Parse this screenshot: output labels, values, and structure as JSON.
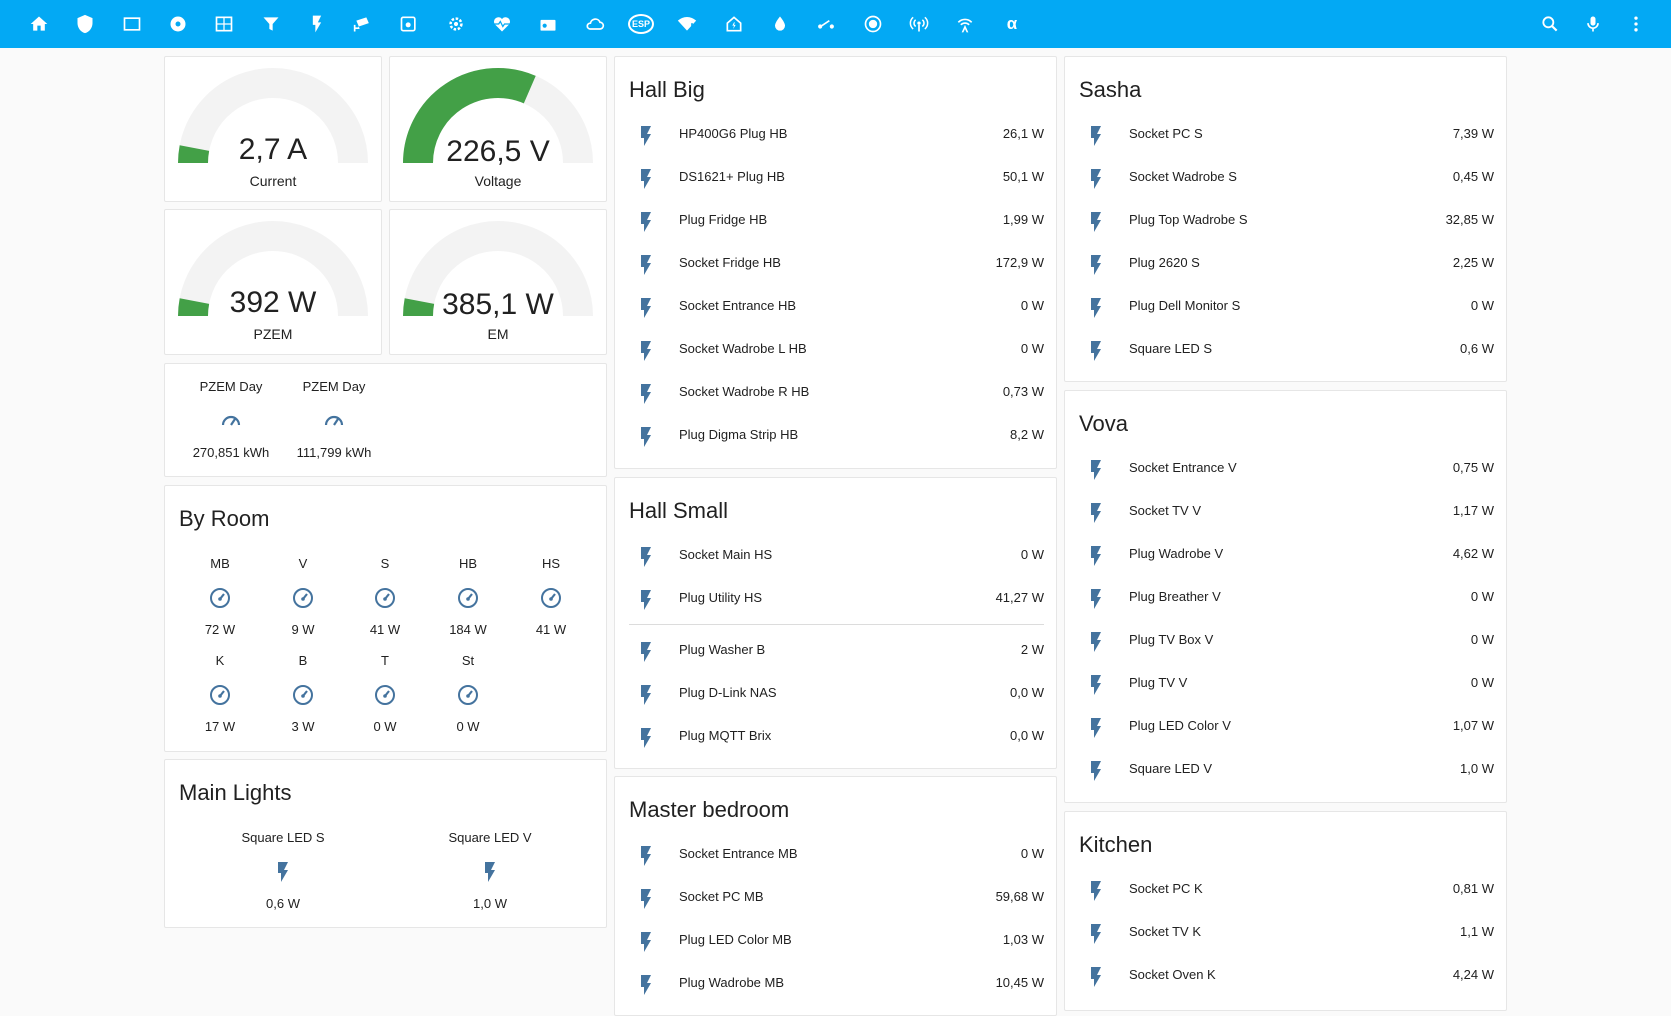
{
  "topbar": {
    "icons": [
      "home-icon",
      "shield-icon",
      "tablet-icon",
      "disc-icon",
      "calendar-icon",
      "filter-icon",
      "flash-icon",
      "cctv-icon",
      "camera-badge-icon",
      "gear-icon",
      "heart-pulse-icon",
      "radio-icon",
      "cloud-icon",
      "esp-icon",
      "wifi-warning-icon",
      "home-lightning-icon",
      "water-icon",
      "switch-icon",
      "record-icon",
      "access-point-icon",
      "antenna-icon",
      "alpha-icon"
    ],
    "esp_label": "ESP",
    "alpha_label": "α",
    "right_icons": [
      "search-icon",
      "microphone-icon",
      "menu-dots-icon"
    ]
  },
  "colors": {
    "accent": "#03a9f4",
    "gauge_green": "#43a047",
    "icon_blue": "#44739e",
    "gauge_track": "#f3f3f3"
  },
  "gauges": [
    {
      "value": "2,7 A",
      "label": "Current",
      "fill": 0.06
    },
    {
      "value": "226,5 V",
      "label": "Voltage",
      "fill": 0.63
    },
    {
      "value": "392 W",
      "label": "PZEM",
      "fill": 0.06
    },
    {
      "value": "385,1 W",
      "label": "EM",
      "fill": 0.06
    }
  ],
  "pzem_day": [
    {
      "name": "PZEM Day",
      "value": "270,851 kWh"
    },
    {
      "name": "PZEM Day",
      "value": "111,799 kWh"
    }
  ],
  "by_room": {
    "title": "By Room",
    "items": [
      {
        "name": "MB",
        "value": "72 W"
      },
      {
        "name": "V",
        "value": "9 W"
      },
      {
        "name": "S",
        "value": "41 W"
      },
      {
        "name": "HB",
        "value": "184 W"
      },
      {
        "name": "HS",
        "value": "41 W"
      },
      {
        "name": "K",
        "value": "17 W"
      },
      {
        "name": "B",
        "value": "3 W"
      },
      {
        "name": "T",
        "value": "0 W"
      },
      {
        "name": "St",
        "value": "0 W"
      }
    ]
  },
  "main_lights": {
    "title": "Main Lights",
    "items": [
      {
        "name": "Square LED S",
        "value": "0,6 W"
      },
      {
        "name": "Square LED V",
        "value": "1,0 W"
      }
    ]
  },
  "hall_big": {
    "title": "Hall Big",
    "rows": [
      {
        "name": "HP400G6 Plug HB",
        "value": "26,1 W"
      },
      {
        "name": "DS1621+ Plug HB",
        "value": "50,1 W"
      },
      {
        "name": "Plug Fridge HB",
        "value": "1,99 W"
      },
      {
        "name": "Socket Fridge HB",
        "value": "172,9 W"
      },
      {
        "name": "Socket Entrance HB",
        "value": "0 W"
      },
      {
        "name": "Socket Wadrobe L HB",
        "value": "0 W"
      },
      {
        "name": "Socket Wadrobe R HB",
        "value": "0,73 W"
      },
      {
        "name": "Plug Digma Strip HB",
        "value": "8,2 W"
      }
    ]
  },
  "hall_small": {
    "title": "Hall Small",
    "rows": [
      {
        "name": "Socket Main HS",
        "value": "0 W"
      },
      {
        "name": "Plug Utility HS",
        "value": "41,27 W"
      }
    ],
    "rows_after_divider": [
      {
        "name": "Plug Washer B",
        "value": "2 W"
      },
      {
        "name": "Plug D-Link NAS",
        "value": "0,0 W"
      },
      {
        "name": "Plug MQTT Brix",
        "value": "0,0 W"
      }
    ]
  },
  "master_bedroom": {
    "title": "Master bedroom",
    "rows": [
      {
        "name": "Socket Entrance MB",
        "value": "0 W"
      },
      {
        "name": "Socket PC MB",
        "value": "59,68 W"
      },
      {
        "name": "Plug LED Color MB",
        "value": "1,03 W"
      },
      {
        "name": "Plug Wadrobe MB",
        "value": "10,45 W"
      }
    ]
  },
  "sasha": {
    "title": "Sasha",
    "rows": [
      {
        "name": "Socket PC S",
        "value": "7,39 W"
      },
      {
        "name": "Socket Wadrobe S",
        "value": "0,45 W"
      },
      {
        "name": "Plug Top Wadrobe S",
        "value": "32,85 W"
      },
      {
        "name": "Plug 2620 S",
        "value": "2,25 W"
      },
      {
        "name": "Plug Dell Monitor S",
        "value": "0 W"
      },
      {
        "name": "Square LED S",
        "value": "0,6 W"
      }
    ]
  },
  "vova": {
    "title": "Vova",
    "rows": [
      {
        "name": "Socket Entrance V",
        "value": "0,75 W"
      },
      {
        "name": "Socket TV V",
        "value": "1,17 W"
      },
      {
        "name": "Plug Wadrobe V",
        "value": "4,62 W"
      },
      {
        "name": "Plug Breather V",
        "value": "0 W"
      },
      {
        "name": "Plug TV Box V",
        "value": "0 W"
      },
      {
        "name": "Plug TV V",
        "value": "0 W"
      },
      {
        "name": "Plug LED Color V",
        "value": "1,07 W"
      },
      {
        "name": "Square LED V",
        "value": "1,0 W"
      }
    ]
  },
  "kitchen": {
    "title": "Kitchen",
    "rows": [
      {
        "name": "Socket PC K",
        "value": "0,81 W"
      },
      {
        "name": "Socket TV K",
        "value": "1,1 W"
      },
      {
        "name": "Socket Oven K",
        "value": "4,24 W"
      }
    ]
  }
}
